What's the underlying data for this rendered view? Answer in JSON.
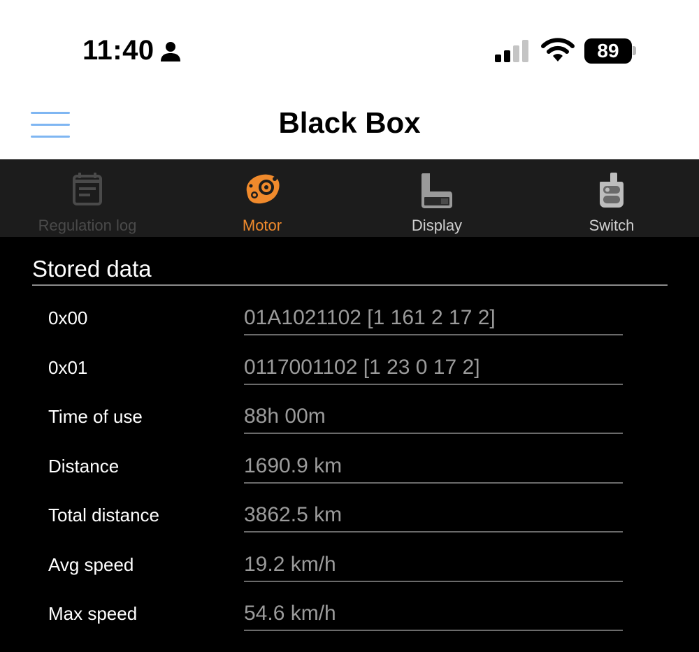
{
  "status_bar": {
    "time": "11:40",
    "battery": "89",
    "icons": [
      "person-icon",
      "cellular-signal-icon",
      "wifi-icon",
      "battery-icon"
    ]
  },
  "nav": {
    "title": "Black Box",
    "menu_icon": "hamburger-menu-icon"
  },
  "tabs": [
    {
      "label": "Regulation log",
      "icon": "log-icon",
      "state": "disabled",
      "color": "#4a4a4a"
    },
    {
      "label": "Motor",
      "icon": "motor-icon",
      "state": "active",
      "color": "#f08a2c"
    },
    {
      "label": "Display",
      "icon": "display-unit-icon",
      "state": "normal",
      "color": "#cfcfcf"
    },
    {
      "label": "Switch",
      "icon": "remote-switch-icon",
      "state": "normal",
      "color": "#cfcfcf"
    }
  ],
  "section": {
    "title": "Stored data"
  },
  "rows": [
    {
      "label": "0x00",
      "value": "01A1021102 [1 161 2 17 2]"
    },
    {
      "label": "0x01",
      "value": "0117001102 [1 23 0 17 2]"
    },
    {
      "label": "Time of use",
      "value": "88h 00m"
    },
    {
      "label": "Distance",
      "value": "1690.9 km"
    },
    {
      "label": "Total distance",
      "value": "3862.5 km"
    },
    {
      "label": "Avg speed",
      "value": "19.2 km/h"
    },
    {
      "label": "Max speed",
      "value": "54.6 km/h"
    }
  ],
  "colors": {
    "accent": "#f08a2c",
    "menu": "#7fb6f2",
    "tab_bar_bg": "#1c1c1c",
    "value_text": "#9b9b9b"
  }
}
